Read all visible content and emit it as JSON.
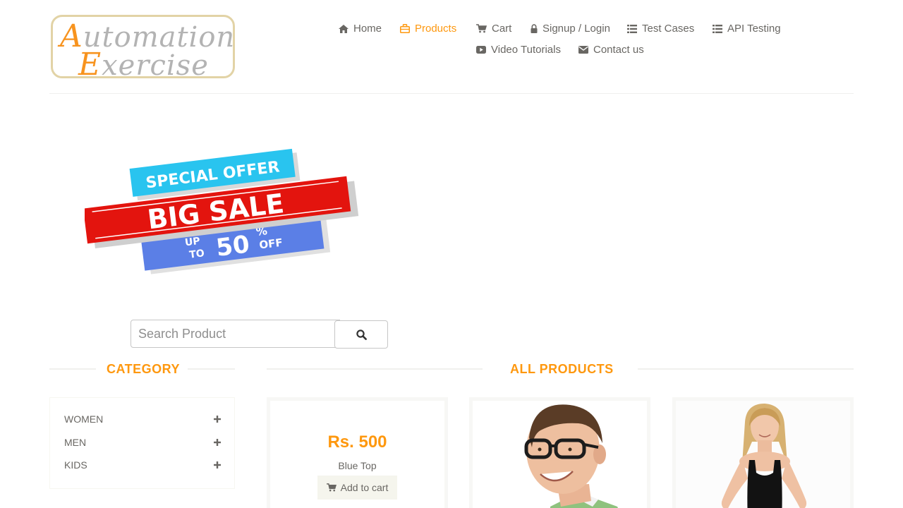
{
  "logo": {
    "line1_cap": "A",
    "line1_rest": "utomation",
    "line2_cap": "E",
    "line2_rest": "xercise"
  },
  "nav": {
    "home": "Home",
    "products": "Products",
    "cart": "Cart",
    "signup_login": "Signup / Login",
    "test_cases": "Test Cases",
    "api_testing": "API Testing",
    "video_tutorials": "Video Tutorials",
    "contact_us": "Contact us",
    "active": "Products"
  },
  "banner": {
    "line1": "SPECIAL OFFER",
    "line2": "BIG SALE",
    "up": "UP",
    "to": "TO",
    "percent_value": "50",
    "percent_sign": "%",
    "off": "OFF"
  },
  "search": {
    "placeholder": "Search Product",
    "value": ""
  },
  "sidebar": {
    "title": "CATEGORY",
    "categories": [
      {
        "label": "WOMEN"
      },
      {
        "label": "MEN"
      },
      {
        "label": "KIDS"
      }
    ]
  },
  "main": {
    "title": "ALL PRODUCTS",
    "products": [
      {
        "price": "Rs. 500",
        "name": "Blue Top",
        "button": "Add to cart"
      },
      {
        "price": "",
        "name": "",
        "button": ""
      },
      {
        "price": "",
        "name": "",
        "button": ""
      }
    ]
  },
  "colors": {
    "accent": "#FE980F",
    "text": "#696763",
    "banner_cyan": "#29C4EF",
    "banner_red": "#E3140E",
    "banner_blue": "#5B7FE6"
  }
}
